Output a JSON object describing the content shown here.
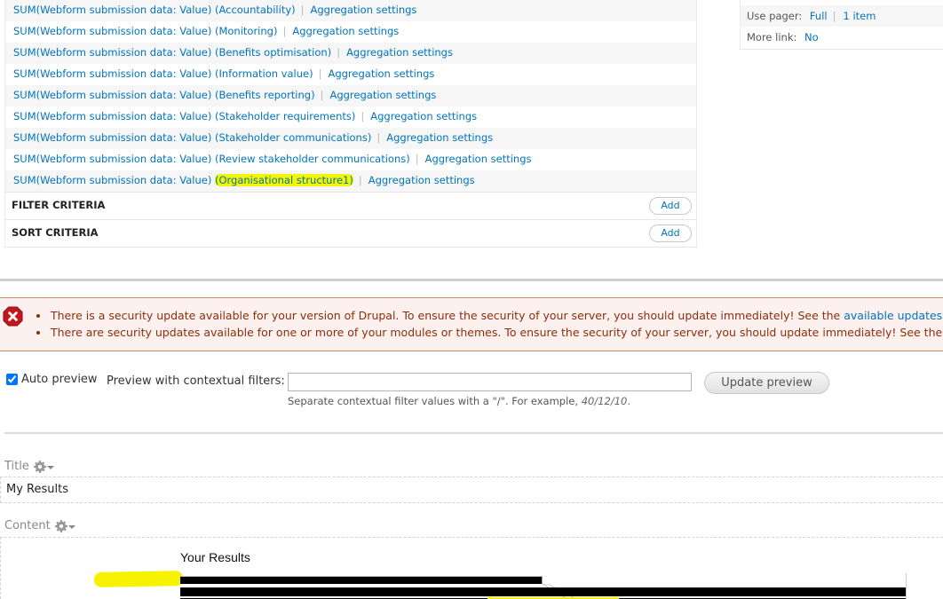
{
  "fields": {
    "rows": [
      {
        "prefix": "SUM(Webform submission data: Value) ",
        "label": "(Accountability)",
        "highlight": false,
        "action": "Aggregation settings"
      },
      {
        "prefix": "SUM(Webform submission data: Value) ",
        "label": "(Monitoring)",
        "highlight": false,
        "action": "Aggregation settings"
      },
      {
        "prefix": "SUM(Webform submission data: Value) ",
        "label": "(Benefits optimisation)",
        "highlight": false,
        "action": "Aggregation settings"
      },
      {
        "prefix": "SUM(Webform submission data: Value) ",
        "label": "(Information value)",
        "highlight": false,
        "action": "Aggregation settings"
      },
      {
        "prefix": "SUM(Webform submission data: Value) ",
        "label": "(Benefits reporting)",
        "highlight": false,
        "action": "Aggregation settings"
      },
      {
        "prefix": "SUM(Webform submission data: Value) ",
        "label": "(Stakeholder requirements)",
        "highlight": false,
        "action": "Aggregation settings"
      },
      {
        "prefix": "SUM(Webform submission data: Value) ",
        "label": "(Stakeholder communications)",
        "highlight": false,
        "action": "Aggregation settings"
      },
      {
        "prefix": "SUM(Webform submission data: Value) ",
        "label": "(Review stakeholder communications)",
        "highlight": false,
        "action": "Aggregation settings"
      },
      {
        "prefix": "SUM(Webform submission data: Value) ",
        "label": "(Organisational structure1)",
        "highlight": true,
        "action": "Aggregation settings"
      }
    ],
    "separator": "|"
  },
  "sections": {
    "filter": {
      "title": "FILTER CRITERIA",
      "add_label": "Add"
    },
    "sort": {
      "title": "SORT CRITERIA",
      "add_label": "Add"
    }
  },
  "settings": {
    "use_pager_label": "Use pager:",
    "use_pager_value": "Full",
    "use_pager_items": "1 item",
    "more_link_label": "More link:",
    "more_link_value": "No",
    "separator": "|"
  },
  "messages": {
    "type": "error",
    "items": [
      {
        "text": "There is a security update available for your version of Drupal. To ensure the security of your server, you should update immediately! See the ",
        "link": "available updates"
      },
      {
        "text": "There are security updates available for one or more of your modules or themes. To ensure the security of your server, you should update immediately! See the",
        "link": ""
      }
    ]
  },
  "preview": {
    "auto_preview_label": "Auto preview",
    "auto_preview_checked": true,
    "contextual_label": "Preview with contextual filters:",
    "contextual_value": "",
    "help_text": "Separate contextual filter values with a \"/\". For example, ",
    "help_example": "40/12/10",
    "help_suffix": ".",
    "update_button": "Update preview"
  },
  "output": {
    "title_label": "Title",
    "title_value": "My Results",
    "content_label": "Content",
    "content_heading": "Your Results"
  },
  "colors": {
    "link": "#0074bd",
    "error_text": "#8c2e0b",
    "error_bg": "#fcf1ee",
    "highlight": "#f5f500"
  }
}
